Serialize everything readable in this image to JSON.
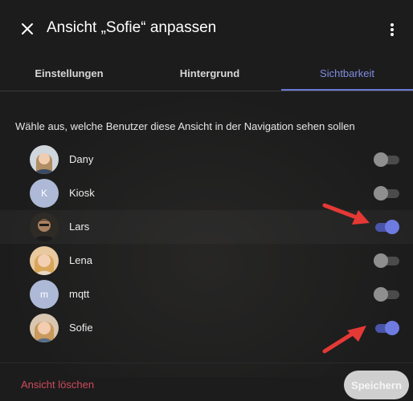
{
  "dialog": {
    "title": "Ansicht „Sofie“ anpassen",
    "close_icon": "close-icon",
    "menu_icon": "more-vertical-icon"
  },
  "tabs": [
    {
      "label": "Einstellungen",
      "active": false
    },
    {
      "label": "Hintergrund",
      "active": false
    },
    {
      "label": "Sichtbarkeit",
      "active": true
    }
  ],
  "visibility": {
    "description": "Wähle aus, welche Benutzer diese Ansicht in der Navigation sehen sollen",
    "users": [
      {
        "name": "Dany",
        "avatar": "photo",
        "visible": false
      },
      {
        "name": "Kiosk",
        "avatar": "K",
        "visible": false
      },
      {
        "name": "Lars",
        "avatar": "photo",
        "visible": true
      },
      {
        "name": "Lena",
        "avatar": "photo",
        "visible": false
      },
      {
        "name": "mqtt",
        "avatar": "m",
        "visible": false
      },
      {
        "name": "Sofie",
        "avatar": "photo",
        "visible": true
      }
    ]
  },
  "footer": {
    "delete_label": "Ansicht löschen",
    "save_label": "Speichern"
  },
  "colors": {
    "accent": "#6e7be0",
    "danger": "#cf4a5c",
    "annotation_arrow": "#e53935"
  }
}
